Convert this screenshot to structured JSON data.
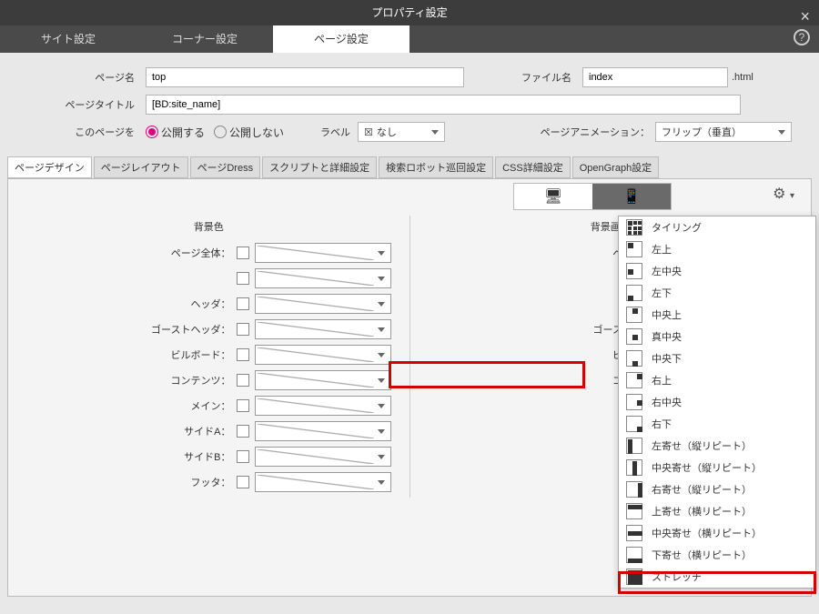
{
  "title": "プロパティ設定",
  "tabs": [
    "サイト設定",
    "コーナー設定",
    "ページ設定"
  ],
  "activeTab": 2,
  "form": {
    "pageNameLabel": "ページ名",
    "pageName": "top",
    "fileNameLabel": "ファイル名",
    "fileName": "index",
    "fileExt": ".html",
    "pageTitleLabel": "ページタイトル",
    "pageTitle": "[BD:site_name]",
    "publishLabel": "このページを",
    "pub": "公開する",
    "nopub": "公開しない",
    "labelLabel": "ラベル",
    "labelVal": "なし",
    "animLabel": "ページアニメーション：",
    "animVal": "フリップ（垂直）"
  },
  "subtabs": [
    "ページデザイン",
    "ページレイアウト",
    "ページDress",
    "スクリプトと詳細設定",
    "検索ロボット巡回設定",
    "CSS詳細設定",
    "OpenGraph設定"
  ],
  "leftHead": "背景色",
  "rightHead": "背景画像",
  "rows": [
    "ページ全体：",
    "",
    "ヘッダ：",
    "ゴーストヘッダ：",
    "ビルボード：",
    "コンテンツ：",
    "メイン：",
    "サイドA：",
    "サイドB：",
    "フッタ："
  ],
  "menu": [
    "タイリング",
    "左上",
    "左中央",
    "左下",
    "中央上",
    "真中央",
    "中央下",
    "右上",
    "右中央",
    "右下",
    "左寄せ（縦リピート）",
    "中央寄せ（縦リピート）",
    "右寄せ（縦リピート）",
    "上寄せ（横リピート）",
    "中央寄せ（横リピート）",
    "下寄せ（横リピート）",
    "ストレッチ"
  ]
}
